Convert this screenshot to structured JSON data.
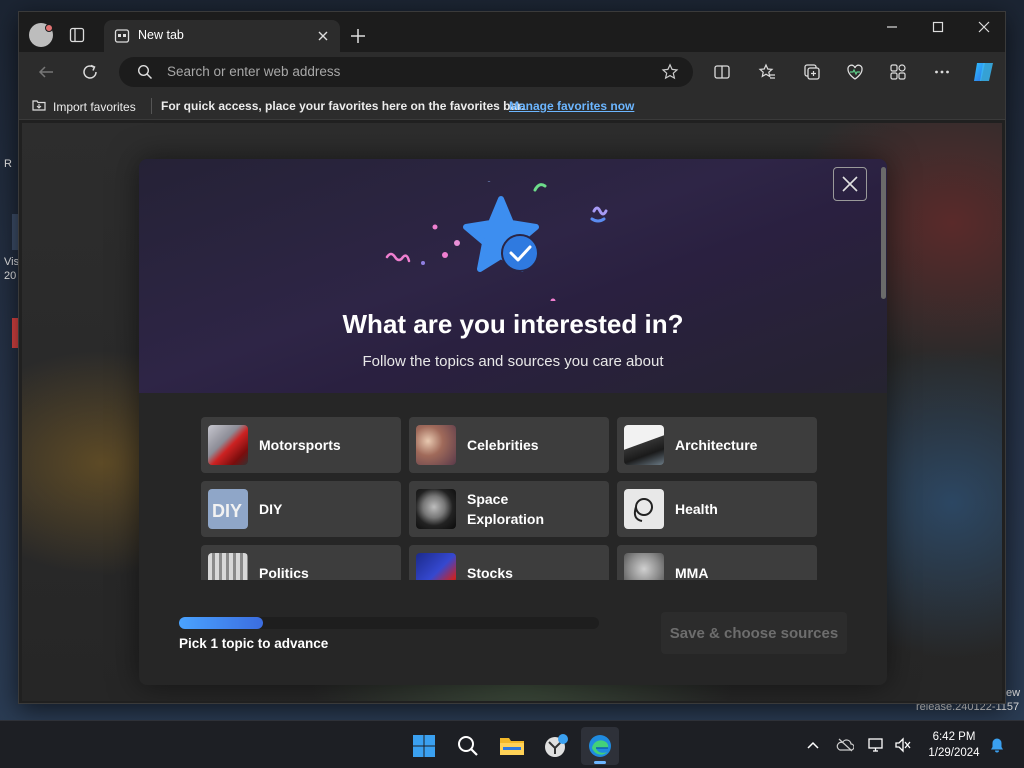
{
  "browser": {
    "tab_title": "New tab",
    "address_placeholder": "Search or enter web address"
  },
  "favorites_bar": {
    "import_label": "Import favorites",
    "message": "For quick access, place your favorites here on the favorites bar.",
    "manage_link": "Manage favorites now"
  },
  "modal": {
    "title": "What are you interested in?",
    "subtitle": "Follow the topics and sources you care about",
    "topics": [
      {
        "label": "Motorsports"
      },
      {
        "label": "Celebrities"
      },
      {
        "label": "Architecture"
      },
      {
        "label": "DIY"
      },
      {
        "label": "Space Exploration"
      },
      {
        "label": "Health"
      },
      {
        "label": "Politics"
      },
      {
        "label": "Stocks"
      },
      {
        "label": "MMA"
      }
    ],
    "progress_fraction": 0.2,
    "progress_label": "Pick 1 topic to advance",
    "save_button": "Save & choose sources"
  },
  "desktop_fragments": {
    "left_1": "R",
    "left_2": "Vis",
    "left_3": "20",
    "right_1": "ew",
    "right_2": "release.240122-1157"
  },
  "taskbar": {
    "time": "6:42 PM",
    "date": "1/29/2024"
  },
  "colors": {
    "accent": "#6cb6ff",
    "progress": "#4aa3ff",
    "star": "#3d8ef0"
  }
}
